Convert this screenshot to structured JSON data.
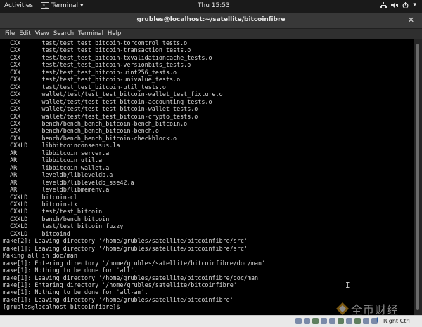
{
  "topbar": {
    "activities": "Activities",
    "app_name": "Terminal",
    "app_chevron": "▾",
    "clock": "Thu 15:53",
    "tray_chevron": "▾",
    "icons": [
      "network-icon",
      "volume-icon",
      "power-icon"
    ]
  },
  "window": {
    "title": "grubles@localhost:~/satellite/bitcoinfibre",
    "close_glyph": "✕"
  },
  "menu": {
    "items": [
      "File",
      "Edit",
      "View",
      "Search",
      "Terminal",
      "Help"
    ]
  },
  "terminal": {
    "lines": [
      "  CXX      test/test_test_bitcoin-torcontrol_tests.o",
      "  CXX      test/test_test_bitcoin-transaction_tests.o",
      "  CXX      test/test_test_bitcoin-txvalidationcache_tests.o",
      "  CXX      test/test_test_bitcoin-versionbits_tests.o",
      "  CXX      test/test_test_bitcoin-uint256_tests.o",
      "  CXX      test/test_test_bitcoin-univalue_tests.o",
      "  CXX      test/test_test_bitcoin-util_tests.o",
      "  CXX      wallet/test/test_test_bitcoin-wallet_test_fixture.o",
      "  CXX      wallet/test/test_test_bitcoin-accounting_tests.o",
      "  CXX      wallet/test/test_test_bitcoin-wallet_tests.o",
      "  CXX      wallet/test/test_test_bitcoin-crypto_tests.o",
      "  CXX      bench/bench_bench_bitcoin-bench_bitcoin.o",
      "  CXX      bench/bench_bench_bitcoin-bench.o",
      "  CXX      bench/bench_bench_bitcoin-checkblock.o",
      "  CXXLD    libbitcoinconsensus.la",
      "  AR       libbitcoin_server.a",
      "  AR       libbitcoin_util.a",
      "  AR       libbitcoin_wallet.a",
      "  AR       leveldb/libleveldb.a",
      "  AR       leveldb/libleveldb_sse42.a",
      "  AR       leveldb/libmemenv.a",
      "  CXXLD    bitcoin-cli",
      "  CXXLD    bitcoin-tx",
      "  CXXLD    test/test_bitcoin",
      "  CXXLD    bench/bench_bitcoin",
      "  CXXLD    test/test_bitcoin_fuzzy",
      "  CXXLD    bitcoind",
      "make[2]: Leaving directory '/home/grubles/satellite/bitcoinfibre/src'",
      "make[1]: Leaving directory '/home/grubles/satellite/bitcoinfibre/src'",
      "Making all in doc/man",
      "make[1]: Entering directory '/home/grubles/satellite/bitcoinfibre/doc/man'",
      "make[1]: Nothing to be done for 'all'.",
      "make[1]: Leaving directory '/home/grubles/satellite/bitcoinfibre/doc/man'",
      "make[1]: Entering directory '/home/grubles/satellite/bitcoinfibre'",
      "make[1]: Nothing to be done for 'all-am'.",
      "make[1]: Leaving directory '/home/grubles/satellite/bitcoinfibre'",
      "[grubles@localhost bitcoinfibre]$ "
    ]
  },
  "statusbar": {
    "host_key": "Right Ctrl",
    "host_arrow": "⬇"
  },
  "watermark": {
    "text": "全币财经"
  },
  "colors": {
    "terminal_bg": "#000000",
    "terminal_fg": "#d8d8d8",
    "topbar_bg": "#1a1a1a",
    "titlebar_bg": "#383838"
  }
}
